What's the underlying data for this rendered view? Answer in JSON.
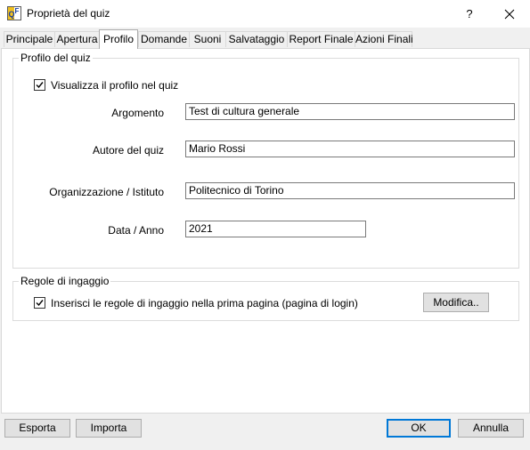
{
  "window": {
    "title": "Proprietà del quiz",
    "help_symbol": "?",
    "close_symbol": "✕",
    "icon_letters": [
      "Q",
      "F"
    ]
  },
  "tabs": [
    {
      "label": "Principale"
    },
    {
      "label": "Apertura"
    },
    {
      "label": "Profilo",
      "active": true
    },
    {
      "label": "Domande"
    },
    {
      "label": "Suoni"
    },
    {
      "label": "Salvataggio"
    },
    {
      "label": "Report Finale"
    },
    {
      "label": "Azioni Finali"
    }
  ],
  "profile": {
    "legend": "Profilo del quiz",
    "show_checkbox": {
      "label": "Visualizza il profilo nel quiz",
      "checked": true
    },
    "fields": {
      "argomento": {
        "label": "Argomento",
        "value": "Test di cultura generale"
      },
      "autore": {
        "label": "Autore del quiz",
        "value": "Mario Rossi"
      },
      "organizzazione": {
        "label": "Organizzazione / Istituto",
        "value": "Politecnico di Torino"
      },
      "data": {
        "label": "Data / Anno",
        "value": "2021"
      }
    }
  },
  "rules": {
    "legend": "Regole di ingaggio",
    "checkbox": {
      "label": "Inserisci le regole di ingaggio nella prima pagina (pagina di login)",
      "checked": true
    },
    "edit_button": "Modifica.."
  },
  "footer": {
    "export_button": "Esporta",
    "import_button": "Importa",
    "ok_button": "OK",
    "cancel_button": "Annulla"
  },
  "colors": {
    "focus_border": "#0078d7",
    "button_face": "#e1e1e1",
    "window_bg": "#f0f0f0"
  }
}
